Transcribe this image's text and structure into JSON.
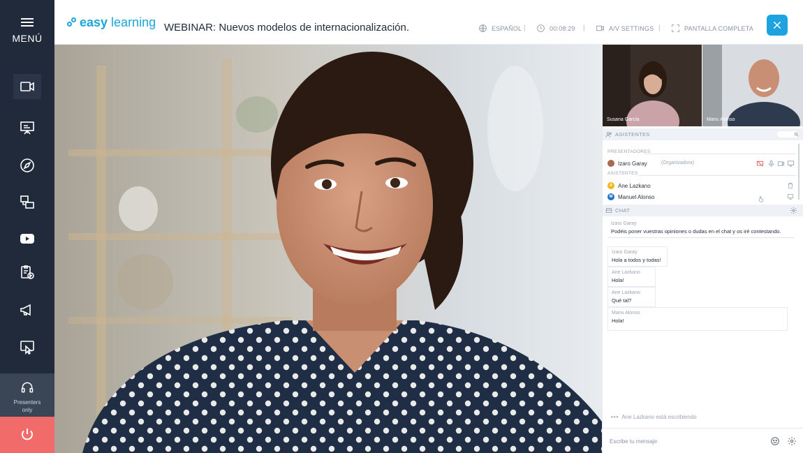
{
  "sidebar": {
    "menu_label": "MENÚ",
    "items": [
      {
        "icon": "video-camera-icon"
      },
      {
        "icon": "presentation-board-icon"
      },
      {
        "icon": "compass-icon"
      },
      {
        "icon": "screens-share-icon"
      },
      {
        "icon": "youtube-icon"
      },
      {
        "icon": "clipboard-check-icon"
      },
      {
        "icon": "megaphone-icon"
      },
      {
        "icon": "cursor-screen-icon"
      }
    ],
    "presenters_label_1": "Presenters",
    "presenters_label_2": "only"
  },
  "header": {
    "logo_a": "easy",
    "logo_b": "learning",
    "title": "WEBINAR: Nuevos modelos de internacionalización.",
    "language": "ESPAÑOL",
    "timer": "00:08:29",
    "av_settings": "A/V SETTINGS",
    "fullscreen": "PANTALLA COMPLETA"
  },
  "thumbnails": [
    {
      "name": "Susana García"
    },
    {
      "name": "Manu Alonso"
    }
  ],
  "attendees": {
    "title": "ASISTENTES",
    "presenters_label": "PRESENTADORES",
    "presenter": {
      "name": "Izaro Garay",
      "role": "(Organizadora)"
    },
    "attendees_label": "ASISTENTES",
    "list": [
      {
        "name": "Ane Lazkano",
        "initial": "A",
        "color": "#f2b619"
      },
      {
        "name": "Manuel Alonso",
        "initial": "M",
        "color": "#1f6fd1"
      }
    ]
  },
  "chat": {
    "title": "CHAT",
    "pinned": {
      "author": "Izaro Garay",
      "text": "Podéis poner vuestras opiniones o dudas en el chat y os iré contestando."
    },
    "messages": [
      {
        "author": "Izaro Garay",
        "text": "Hola a todos y todas!"
      },
      {
        "author": "Ane Lazkano",
        "text": "Hola!"
      },
      {
        "author": "Ane Lazkano",
        "text": "Qué tal?"
      },
      {
        "author": "Manu Alonso",
        "text": "Hola!"
      }
    ],
    "typing": "Ane Lazkano está escribiendo",
    "input_placeholder": "Escribe tu mensaje"
  },
  "colors": {
    "sidebar": "#202a3a",
    "accent": "#1ea3e0",
    "power": "#f26b6b"
  }
}
